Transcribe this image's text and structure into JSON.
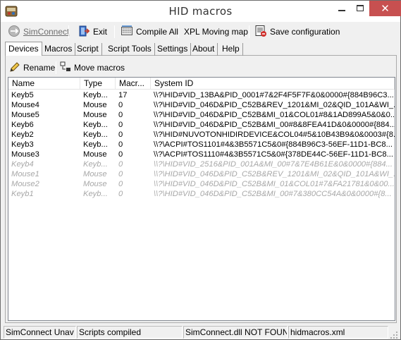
{
  "window": {
    "title": "HID macros"
  },
  "toolbar": {
    "simconnect": {
      "label": "SimConnect",
      "icon": "simconnect-disabled-icon",
      "enabled": false
    },
    "exit": {
      "label": "Exit",
      "icon": "exit-door-icon"
    },
    "compile_all": {
      "label": "Compile All",
      "icon": "compile-icon"
    },
    "xpl": {
      "label": "XPL Moving map"
    },
    "save_config": {
      "label": "Save configuration",
      "icon": "save-configuration-icon"
    }
  },
  "tabs": [
    {
      "label": "Devices",
      "active": true
    },
    {
      "label": "Macros"
    },
    {
      "label": "Script"
    },
    {
      "label": "Script Tools"
    },
    {
      "label": "Settings"
    },
    {
      "label": "About"
    },
    {
      "label": "Help"
    }
  ],
  "devices_toolbar": {
    "rename": {
      "label": "Rename",
      "icon": "rename-pencil-icon"
    },
    "move_macros": {
      "label": "Move macros",
      "icon": "move-macros-icon"
    }
  },
  "device_list": {
    "columns": [
      "Name",
      "Type",
      "Macr...",
      "System ID"
    ],
    "rows": [
      {
        "name": "Keyb5",
        "type": "Keyb...",
        "macros": "17",
        "system_id": "\\\\?\\HID#VID_13BA&PID_0001#7&2F4F5F7F&0&0000#{884B96C3...",
        "active": true
      },
      {
        "name": "Mouse4",
        "type": "Mouse",
        "macros": "0",
        "system_id": "\\\\?\\HID#VID_046D&PID_C52B&REV_1201&MI_02&QID_101A&WI_...",
        "active": true
      },
      {
        "name": "Mouse5",
        "type": "Mouse",
        "macros": "0",
        "system_id": "\\\\?\\HID#VID_046D&PID_C52B&MI_01&COL01#8&1AD899A5&0&0...",
        "active": true
      },
      {
        "name": "Keyb6",
        "type": "Keyb...",
        "macros": "0",
        "system_id": "\\\\?\\HID#VID_046D&PID_C52B&MI_00#8&8FEA41D&0&0000#{884...",
        "active": true
      },
      {
        "name": "Keyb2",
        "type": "Keyb...",
        "macros": "0",
        "system_id": "\\\\?\\HID#NUVOTONHIDIRDEVICE&COL04#5&10B43B9&0&0003#{8...",
        "active": true
      },
      {
        "name": "Keyb3",
        "type": "Keyb...",
        "macros": "0",
        "system_id": "\\\\?\\ACPI#TOS1101#4&3B5571C5&0#{884B96C3-56EF-11D1-BC8...",
        "active": true
      },
      {
        "name": "Mouse3",
        "type": "Mouse",
        "macros": "0",
        "system_id": "\\\\?\\ACPI#TOS1110#4&3B5571C5&0#{378DE44C-56EF-11D1-BC8...",
        "active": true
      },
      {
        "name": "Keyb4",
        "type": "Keyb...",
        "macros": "0",
        "system_id": "\\\\?\\HID#VID_2516&PID_001A&MI_00#7&7E4B61E&0&0000#{884...",
        "active": false
      },
      {
        "name": "Mouse1",
        "type": "Mouse",
        "macros": "0",
        "system_id": "\\\\?\\HID#VID_046D&PID_C52B&REV_1201&MI_02&QID_101A&WI_...",
        "active": false
      },
      {
        "name": "Mouse2",
        "type": "Mouse",
        "macros": "0",
        "system_id": "\\\\?\\HID#VID_046D&PID_C52B&MI_01&COL01#7&FA21781&0&00...",
        "active": false
      },
      {
        "name": "Keyb1",
        "type": "Keyb...",
        "macros": "0",
        "system_id": "\\\\?\\HID#VID_046D&PID_C52B&MI_00#7&380CC54A&0&0000#{8...",
        "active": false
      }
    ]
  },
  "statusbar": {
    "simconnect": "SimConnect Unav",
    "scripts": "Scripts compiled",
    "dll": "SimConnect.dll NOT FOUN",
    "file": "hidmacros.xml"
  },
  "colors": {
    "close_button": "#c75050",
    "inactive_row_text": "#a8a8a8"
  }
}
